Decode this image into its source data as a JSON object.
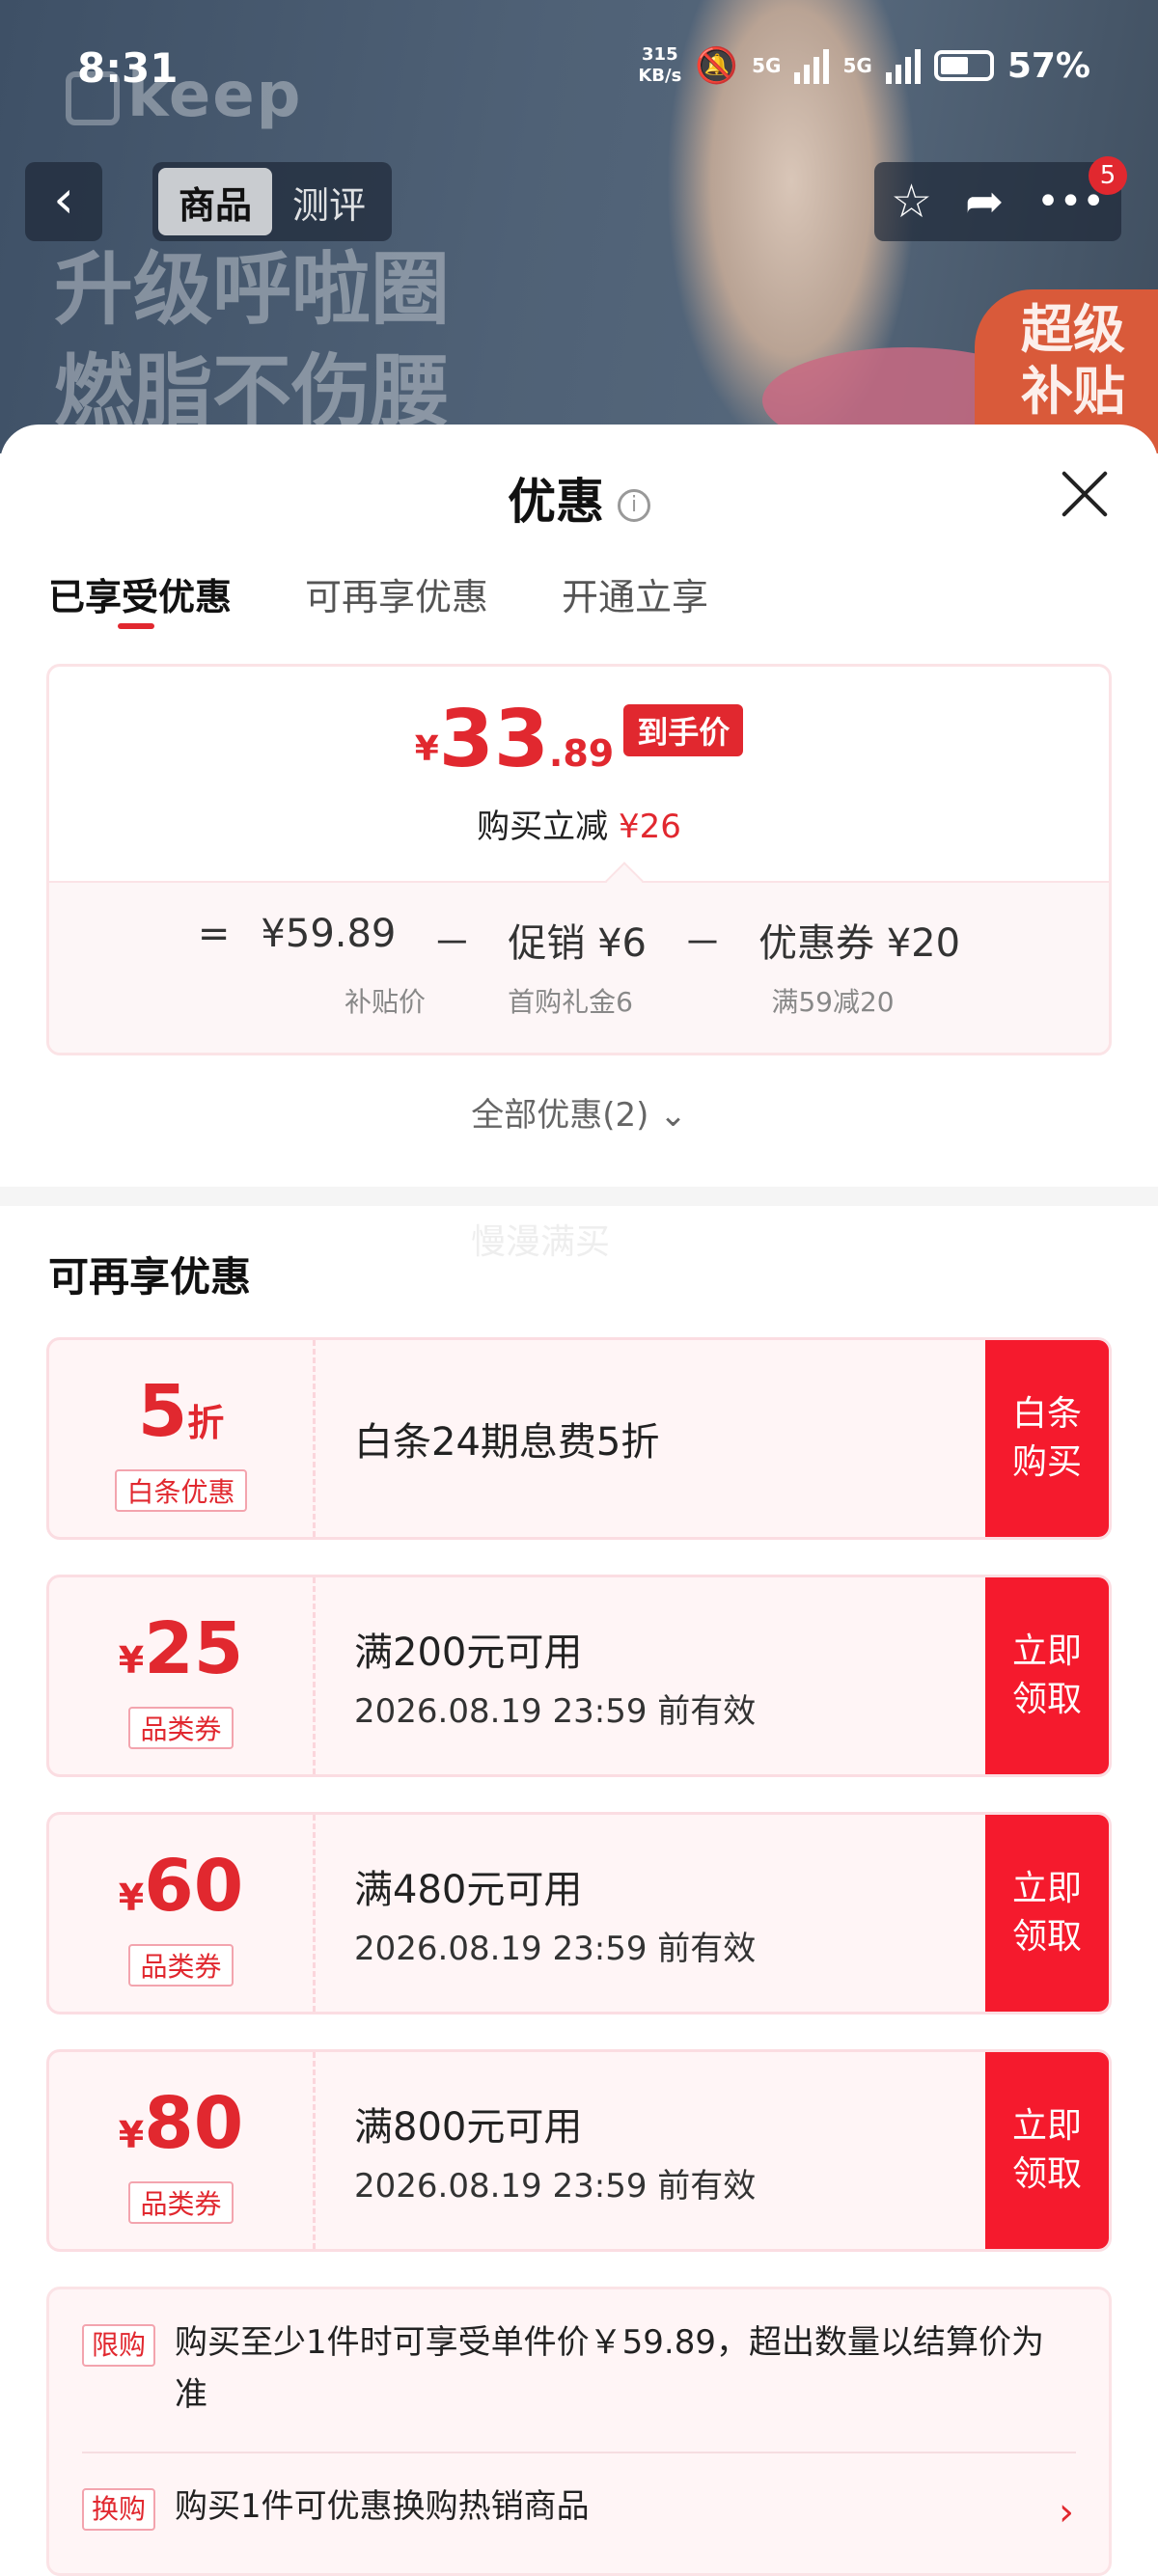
{
  "status": {
    "time": "8:31",
    "speed": "315",
    "speed_unit": "KB/s",
    "net1": "5G",
    "net2": "5G",
    "battery": "57%"
  },
  "header": {
    "logo": "keep",
    "tabs": [
      "商品",
      "测评"
    ],
    "slogan": [
      "升级呼啦圈",
      "燃脂不伤腰"
    ],
    "subsidy": [
      "超级",
      "补贴"
    ],
    "more_badge": "5"
  },
  "sheet": {
    "title": "优惠",
    "tabs": [
      "已享受优惠",
      "可再享优惠",
      "开通立享"
    ]
  },
  "price_card": {
    "yen": "¥",
    "int": "33",
    "dec": ".89",
    "tag": "到手价",
    "save_label": "购买立减",
    "save_value": "¥26",
    "formula": {
      "eq": "=",
      "base": "¥59.89",
      "minus1": "－",
      "promo": "促销 ¥6",
      "minus2": "－",
      "coupon": "优惠券 ¥20"
    },
    "sublabels": {
      "base": "补贴价",
      "promo": "首购礼金6",
      "coupon": "满59减20"
    }
  },
  "all_discounts": "全部优惠(2)",
  "watermark": "慢漫满买",
  "reenjoy": {
    "title": "可再享优惠",
    "coupons": [
      {
        "prefix": "",
        "amount": "5",
        "suffix": "折",
        "type": "白条优惠",
        "line1": "白条24期息费5折",
        "line2": "",
        "btn": [
          "白条",
          "购买"
        ]
      },
      {
        "prefix": "¥",
        "amount": "25",
        "suffix": "",
        "type": "品类券",
        "line1": "满200元可用",
        "line2": "2026.08.19 23:59 前有效",
        "btn": [
          "立即",
          "领取"
        ]
      },
      {
        "prefix": "¥",
        "amount": "60",
        "suffix": "",
        "type": "品类券",
        "line1": "满480元可用",
        "line2": "2026.08.19 23:59 前有效",
        "btn": [
          "立即",
          "领取"
        ]
      },
      {
        "prefix": "¥",
        "amount": "80",
        "suffix": "",
        "type": "品类券",
        "line1": "满800元可用",
        "line2": "2026.08.19 23:59 前有效",
        "btn": [
          "立即",
          "领取"
        ]
      }
    ]
  },
  "rules": [
    {
      "tag": "限购",
      "text": "购买至少1件时可享受单件价￥59.89，超出数量以结算价为准"
    },
    {
      "tag": "换购",
      "text": "购买1件可优惠换购热销商品"
    }
  ]
}
